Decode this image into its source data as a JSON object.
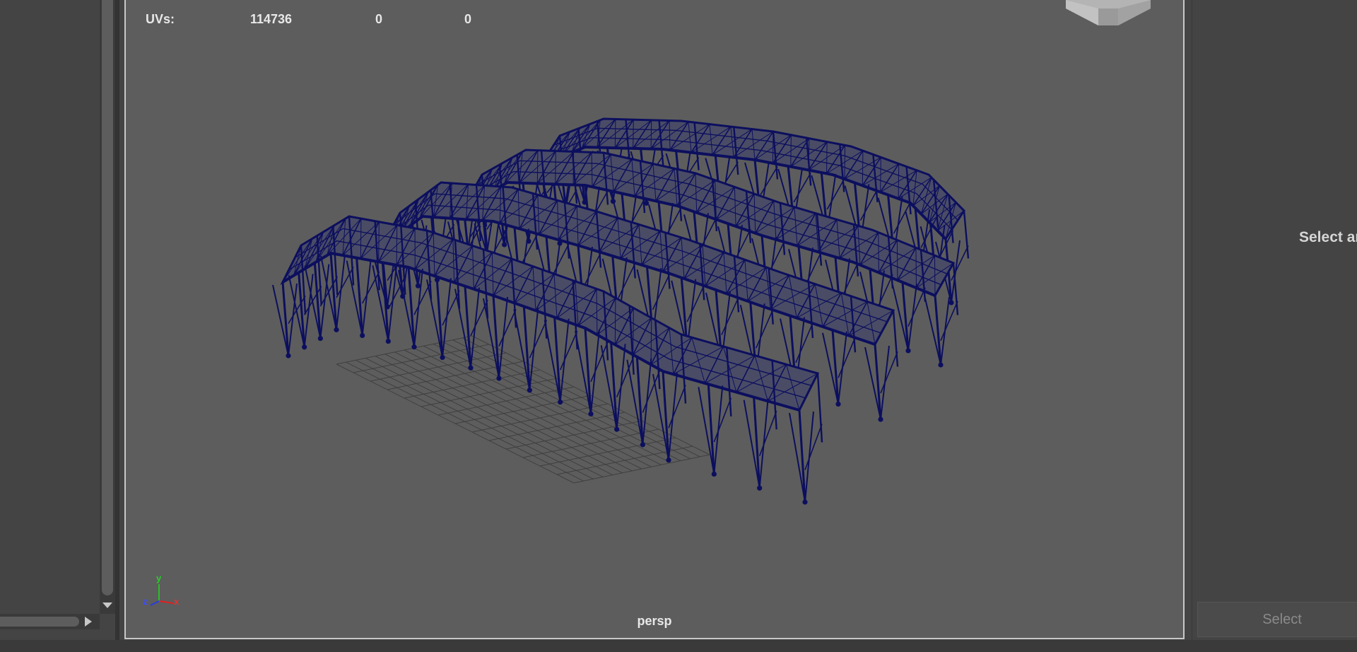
{
  "viewport": {
    "hud": {
      "uvs_label": "UVs:",
      "uvs_values": [
        "114736",
        "0",
        "0"
      ]
    },
    "camera_name": "persp",
    "axes": {
      "x": "x",
      "y": "y",
      "z": "z"
    },
    "wireframe_color": "#0c0f5e",
    "background_color": "#5d5d5d"
  },
  "attribute_editor": {
    "message": "Select an",
    "select_button": "Select"
  },
  "icons": {
    "viewcube": "view-cube-icon",
    "axis": "axis-gizmo-icon",
    "scroll_down": "triangle-down-icon",
    "scroll_right": "triangle-right-icon"
  }
}
